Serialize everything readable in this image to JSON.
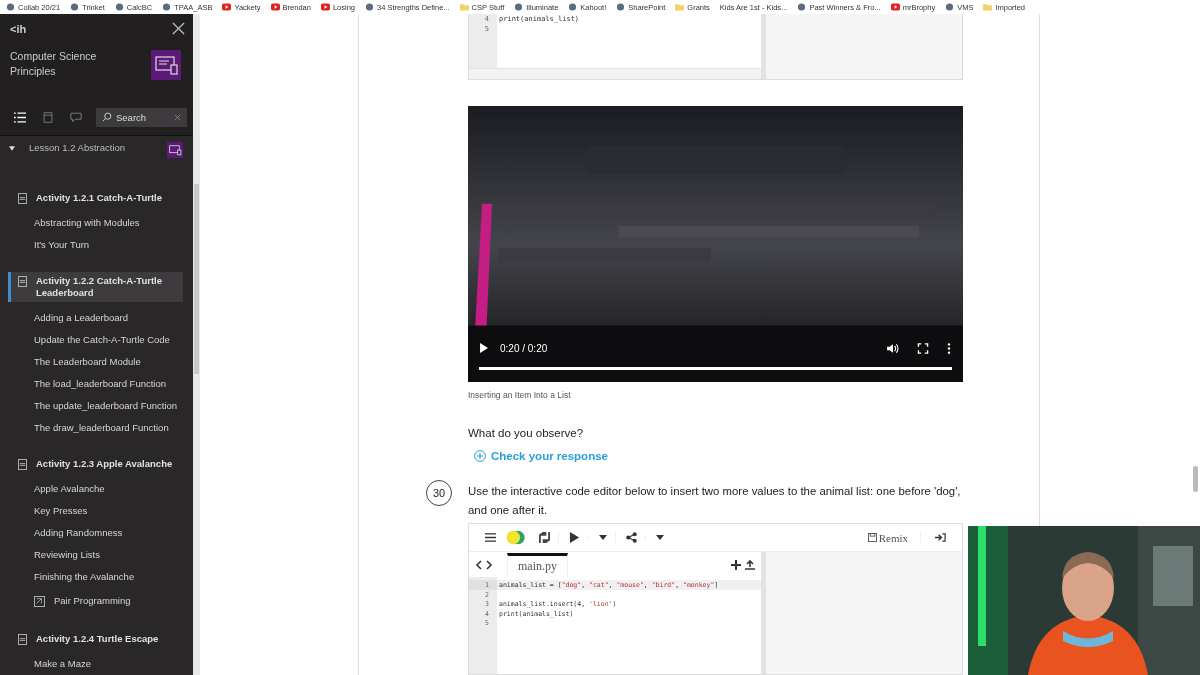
{
  "bookmarks": [
    {
      "label": "Collab 20/21",
      "kind": "site"
    },
    {
      "label": "Trinket",
      "kind": "site"
    },
    {
      "label": "CalcBC",
      "kind": "site"
    },
    {
      "label": "TPAA_ASB",
      "kind": "site"
    },
    {
      "label": "Yackety",
      "kind": "video"
    },
    {
      "label": "Brendan",
      "kind": "video"
    },
    {
      "label": "Losing",
      "kind": "video"
    },
    {
      "label": "34 Strengths Define...",
      "kind": "site"
    },
    {
      "label": "CSP Stuff",
      "kind": "folder"
    },
    {
      "label": "Illuminate",
      "kind": "site"
    },
    {
      "label": "Kahoot!",
      "kind": "site"
    },
    {
      "label": "SharePoint",
      "kind": "site"
    },
    {
      "label": "Grants",
      "kind": "folder"
    },
    {
      "label": "Kids Are 1st - Kids...",
      "kind": "plain"
    },
    {
      "label": "Past Winners & Fro...",
      "kind": "site"
    },
    {
      "label": "mrBrophy",
      "kind": "video"
    },
    {
      "label": "VMS",
      "kind": "site"
    },
    {
      "label": "Imported",
      "kind": "folder"
    }
  ],
  "sidebar": {
    "logo": "<ih",
    "title": "Computer Science Principles",
    "tabs": [
      {
        "kind": "list",
        "selected": true
      },
      {
        "kind": "page",
        "selected": false
      },
      {
        "kind": "chat",
        "selected": false
      }
    ],
    "search": {
      "placeholder": "Search"
    },
    "lesson": {
      "label": "Lesson 1.2 Abstraction",
      "expanded": true
    },
    "items": [
      {
        "kind": "activity",
        "label": "Activity 1.2.1 Catch-A-Turtle",
        "selected": false
      },
      {
        "kind": "page",
        "label": "Abstracting with Modules",
        "selected": false
      },
      {
        "kind": "page",
        "label": "It's Your Turn",
        "selected": false
      },
      {
        "kind": "activity",
        "label": "Activity 1.2.2 Catch-A-Turtle Leaderboard",
        "selected": true
      },
      {
        "kind": "page",
        "label": "Adding a Leaderboard",
        "selected": false
      },
      {
        "kind": "page",
        "label": "Update the Catch-A-Turtle Code",
        "selected": false
      },
      {
        "kind": "page",
        "label": "The Leaderboard Module",
        "selected": false
      },
      {
        "kind": "page",
        "label": "The load_leaderboard Function",
        "selected": false
      },
      {
        "kind": "page",
        "label": "The update_leaderboard Function",
        "selected": false
      },
      {
        "kind": "page",
        "label": "The draw_leaderboard Function",
        "selected": false
      },
      {
        "kind": "activity",
        "label": "Activity 1.2.3 Apple Avalanche",
        "selected": false
      },
      {
        "kind": "page",
        "label": "Apple Avalanche",
        "selected": false
      },
      {
        "kind": "page",
        "label": "Key Presses",
        "selected": false
      },
      {
        "kind": "page",
        "label": "Adding Randomness",
        "selected": false
      },
      {
        "kind": "page",
        "label": "Reviewing Lists",
        "selected": false
      },
      {
        "kind": "page",
        "label": "Finishing the Avalanche",
        "selected": false
      },
      {
        "kind": "pair",
        "label": "Pair Programming",
        "selected": false
      },
      {
        "kind": "activity",
        "label": "Activity 1.2.4 Turtle Escape",
        "selected": false
      },
      {
        "kind": "page",
        "label": "Make a Maze",
        "selected": false
      }
    ]
  },
  "top_editor": {
    "lines": [
      {
        "n": "4",
        "code": "print(animals_list)"
      },
      {
        "n": "5"
      }
    ]
  },
  "video": {
    "time": "0:20 / 0:20",
    "level": 1,
    "caption": "Inserting an Item Into a List"
  },
  "question": "What do you observe?",
  "check_link": "Check your response",
  "step": {
    "number": "30",
    "prompt": "Use the interactive code editor below to insert two more values to the animal list: one before 'dog', and one after it."
  },
  "editor": {
    "remix": "Remix",
    "file": "main.py",
    "lines": [
      {
        "n": "1",
        "code": "animals_list = [\"dog\", \"cat\", \"mouse\", \"bird\", \"monkey\"]"
      },
      {
        "n": "2"
      },
      {
        "n": "3",
        "code": "animals_list.insert(4, 'lion')"
      },
      {
        "n": "4",
        "code": "print(animals_list)"
      },
      {
        "n": "5"
      }
    ]
  }
}
